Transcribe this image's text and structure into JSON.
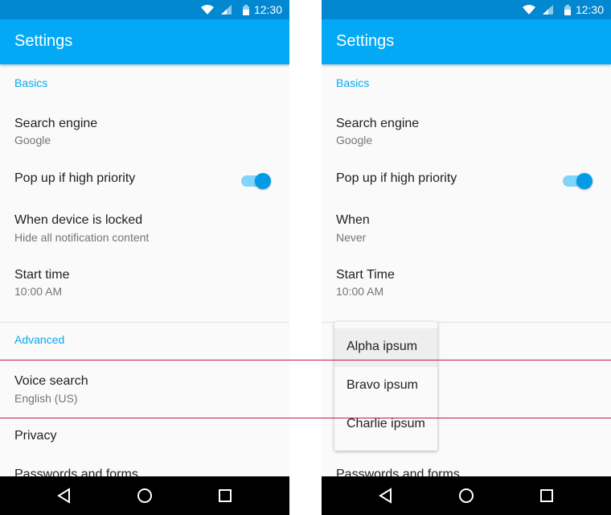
{
  "status": {
    "time": "12:30"
  },
  "left": {
    "title": "Settings",
    "basics": "Basics",
    "search_engine": {
      "label": "Search engine",
      "value": "Google"
    },
    "popup": {
      "label": "Pop up if high priority",
      "on": true
    },
    "locked": {
      "label": "When device is locked",
      "value": "Hide all notification content"
    },
    "start": {
      "label": "Start time",
      "value": "10:00 AM"
    },
    "advanced": "Advanced",
    "voice": {
      "label": "Voice search",
      "value": "English (US)"
    },
    "privacy": "Privacy",
    "passwords": "Passwords and forms"
  },
  "right": {
    "title": "Settings",
    "basics": "Basics",
    "search_engine": {
      "label": "Search engine",
      "value": "Google"
    },
    "popup": {
      "label": "Pop up if high priority",
      "on": true
    },
    "when": {
      "label": "When",
      "value": "Never"
    },
    "start": {
      "label": "Start Time",
      "value": "10:00 AM"
    },
    "menu": [
      "Alpha ipsum",
      "Bravo ipsum",
      "Charlie ipsum"
    ],
    "selected_index": 0,
    "passwords": "Passwords and forms"
  },
  "colors": {
    "status": "#0288d1",
    "appbar": "#03a9f4",
    "accent": "#03a9f4",
    "guide": "#c2185b"
  }
}
